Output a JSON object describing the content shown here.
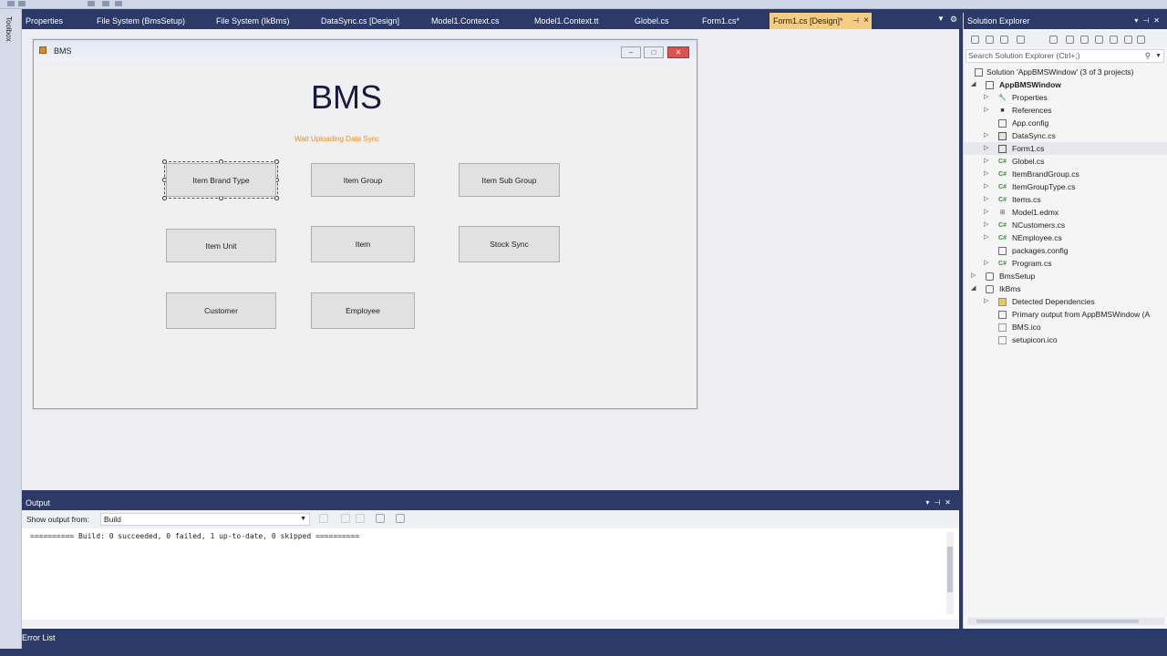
{
  "toolbox_label": "Toolbox",
  "tabs": [
    {
      "label": "Properties"
    },
    {
      "label": "File System (BmsSetup)"
    },
    {
      "label": "File System (IkBms)"
    },
    {
      "label": "DataSync.cs [Design]"
    },
    {
      "label": "Model1.Context.cs"
    },
    {
      "label": "Model1.Context.tt"
    },
    {
      "label": "Globel.cs"
    },
    {
      "label": "Form1.cs*"
    },
    {
      "label": "Form1.cs [Design]*"
    }
  ],
  "form": {
    "window_title": "BMS",
    "heading": "BMS",
    "status_text": "Wait Uploading Data Sync",
    "buttons": [
      "Item Brand Type",
      "Item Group",
      "Item Sub Group",
      "Item Unit",
      "Item",
      "Stock Sync",
      "Customer",
      "Employee"
    ],
    "colors": {
      "status": "#f08c1a",
      "heading": "#1a1a40"
    }
  },
  "solution_explorer": {
    "title": "Solution Explorer",
    "search_placeholder": "Search Solution Explorer (Ctrl+;)",
    "tree": [
      {
        "label": "Solution 'AppBMSWindow' (3 of 3 projects)",
        "icon": "solution-icon"
      },
      {
        "label": "AppBMSWindow",
        "icon": "csharp-project-icon"
      },
      {
        "label": "Properties",
        "icon": "wrench-icon"
      },
      {
        "label": "References",
        "icon": "references-icon"
      },
      {
        "label": "App.config",
        "icon": "config-file-icon"
      },
      {
        "label": "DataSync.cs",
        "icon": "form-icon"
      },
      {
        "label": "Form1.cs",
        "icon": "form-icon"
      },
      {
        "label": "Globel.cs",
        "icon": "csharp-file-icon"
      },
      {
        "label": "ItemBrandGroup.cs",
        "icon": "csharp-file-icon"
      },
      {
        "label": "ItemGroupType.cs",
        "icon": "csharp-file-icon"
      },
      {
        "label": "Items.cs",
        "icon": "csharp-file-icon"
      },
      {
        "label": "Model1.edmx",
        "icon": "edmx-icon"
      },
      {
        "label": "NCustomers.cs",
        "icon": "csharp-file-icon"
      },
      {
        "label": "NEmployee.cs",
        "icon": "csharp-file-icon"
      },
      {
        "label": "packages.config",
        "icon": "config-file-icon"
      },
      {
        "label": "Program.cs",
        "icon": "csharp-file-icon"
      },
      {
        "label": "BmsSetup",
        "icon": "setup-project-icon"
      },
      {
        "label": "IkBms",
        "icon": "setup-project-icon"
      },
      {
        "label": "Detected Dependencies",
        "icon": "folder-icon"
      },
      {
        "label": "Primary output from AppBMSWindow (A",
        "icon": "output-icon"
      },
      {
        "label": "BMS.ico",
        "icon": "file-icon"
      },
      {
        "label": "setupicon.ico",
        "icon": "file-icon"
      }
    ]
  },
  "output": {
    "title": "Output",
    "show_from_label": "Show output from:",
    "source": "Build",
    "text": "========== Build: 0 succeeded, 0 failed, 1 up-to-date, 0 skipped =========="
  },
  "bottom_tab": "Error List"
}
